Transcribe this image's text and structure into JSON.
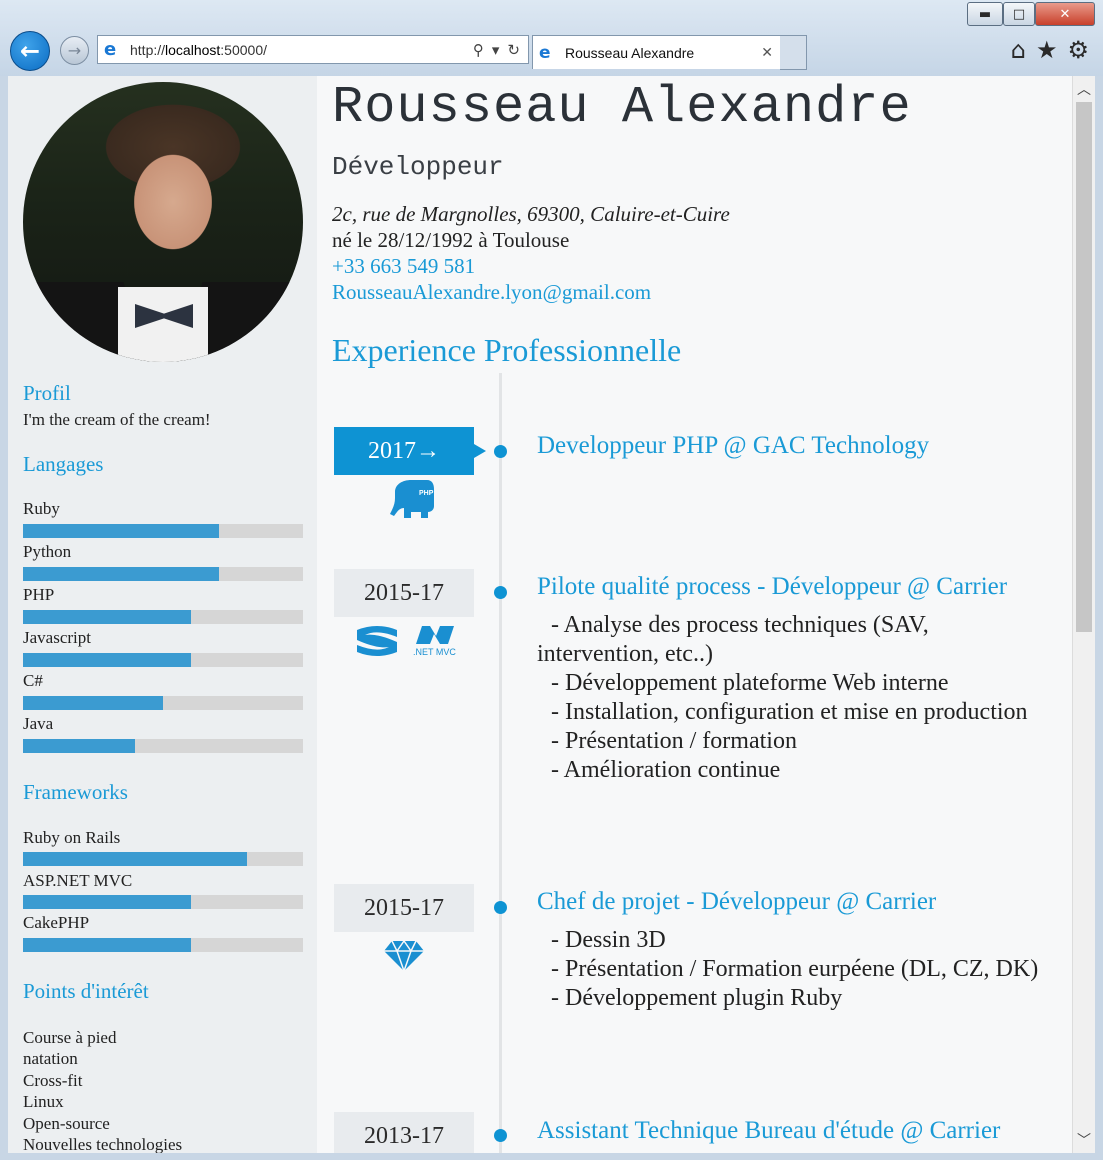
{
  "browser": {
    "url_prefix": "http://",
    "url_host": "localhost",
    "url_suffix": ":50000/",
    "tab_title": "Rousseau Alexandre",
    "controls": {
      "minimize": "▬",
      "maximize": "□",
      "close": "✕"
    }
  },
  "profile": {
    "name": "Rousseau Alexandre",
    "role": "Développeur",
    "address": "2c, rue de Margnolles, 69300, Caluire-et-Cuire",
    "born": "né le 28/12/1992 à Toulouse",
    "phone": "+33 663 549 581",
    "email": "RousseauAlexandre.lyon@gmail.com"
  },
  "sidebar": {
    "profil_title": "Profil",
    "profil_text": "I'm the cream of the cream!",
    "langages_title": "Langages",
    "langages": [
      {
        "label": "Ruby",
        "level": 0.7
      },
      {
        "label": "Python",
        "level": 0.7
      },
      {
        "label": "PHP",
        "level": 0.6
      },
      {
        "label": "Javascript",
        "level": 0.6
      },
      {
        "label": "C#",
        "level": 0.5
      },
      {
        "label": "Java",
        "level": 0.4
      }
    ],
    "frameworks_title": "Frameworks",
    "frameworks": [
      {
        "label": "Ruby on Rails",
        "level": 0.8
      },
      {
        "label": "ASP.NET MVC",
        "level": 0.6
      },
      {
        "label": "CakePHP",
        "level": 0.6
      }
    ],
    "interests_title": "Points d'intérêt",
    "interests": [
      "Course à pied",
      "natation",
      "Cross-fit",
      "Linux",
      "Open-source",
      "Nouvelles technologies"
    ]
  },
  "experience": {
    "title": "Experience Professionnelle",
    "jobs": [
      {
        "date": "2017→",
        "title": "Developpeur PHP @ GAC Technology",
        "lines": []
      },
      {
        "date": "2015-17",
        "title": "Pilote qualité process - Développeur @ Carrier",
        "lines": [
          "- Analyse des process techniques (SAV,",
          "intervention, etc..)",
          "- Développement plateforme Web interne",
          "- Installation, configuration et mise en production",
          "- Présentation / formation",
          "- Amélioration continue"
        ]
      },
      {
        "date": "2015-17",
        "title": "Chef de projet - Développeur @ Carrier",
        "lines": [
          "- Dessin 3D",
          "- Présentation / Formation eurpéene (DL, CZ, DK)",
          "- Développement plugin Ruby"
        ]
      },
      {
        "date": "2013-17",
        "title": "Assistant Technique Bureau d'étude @ Carrier",
        "lines": []
      }
    ],
    "icons": {
      "php": "PHP",
      "net": ".NET MVC"
    }
  }
}
